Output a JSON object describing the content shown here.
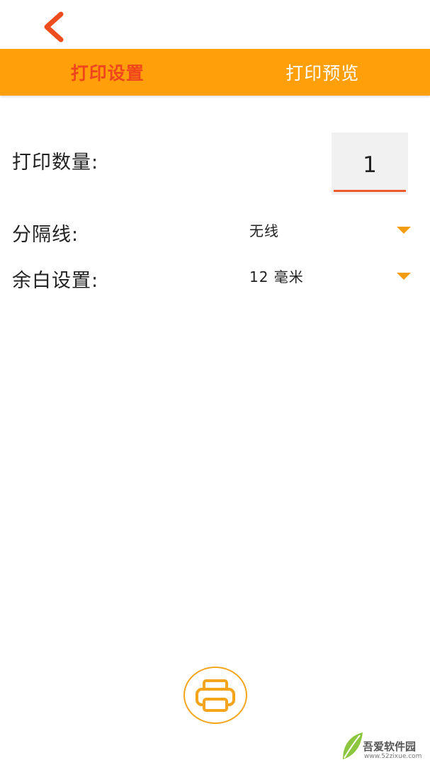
{
  "tabs": [
    {
      "label": "打印设置",
      "active": true
    },
    {
      "label": "打印预览",
      "active": false
    }
  ],
  "form": {
    "quantity_label": "打印数量:",
    "quantity_value": "1",
    "divider_label": "分隔线:",
    "divider_value": "无线",
    "margin_label": "余白设置:",
    "margin_value": "12 毫米"
  },
  "icons": {
    "back": "chevron-left-icon",
    "print": "printer-icon",
    "dropdown": "caret-down-icon"
  },
  "colors": {
    "tab_bar": "#FF9F0A",
    "active_tab": "#F0461E",
    "back_arrow": "#EE4E1F",
    "accent_underline": "#EE5A2C",
    "caret": "#F39C12"
  },
  "watermark": {
    "name": "吾爱软件园",
    "url": "www.52zixue.com"
  }
}
